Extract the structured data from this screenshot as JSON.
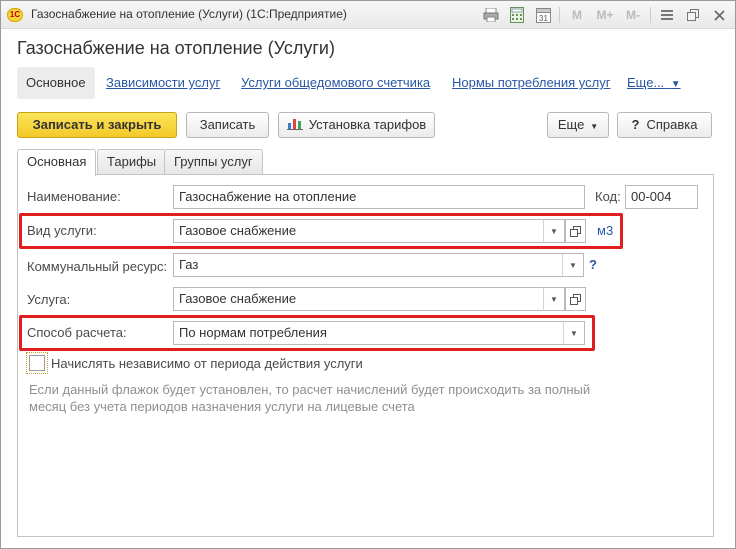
{
  "window": {
    "app_icon_text": "1С",
    "title": "Газоснабжение на отопление (Услуги)  (1С:Предприятие)",
    "toolbar_icons": [
      "print-icon",
      "calculator-icon",
      "calendar-icon",
      "m-button",
      "m-plus-button",
      "m-minus-button",
      "menu-icon",
      "restore-icon",
      "close-icon"
    ],
    "m_labels": {
      "m": "M",
      "mplus": "M+",
      "mminus": "M-"
    },
    "calendar_label": "31"
  },
  "form": {
    "title": "Газоснабжение на отопление (Услуги)"
  },
  "nav": {
    "items": [
      {
        "label": "Основное",
        "active": true
      },
      {
        "label": "Зависимости услуг",
        "active": false
      },
      {
        "label": "Услуги общедомового счетчика",
        "active": false
      },
      {
        "label": "Нормы потребления услуг",
        "active": false
      },
      {
        "label": "Еще...",
        "active": false
      }
    ]
  },
  "toolbar": {
    "save_close": "Записать и закрыть",
    "save": "Записать",
    "tariffs": "Установка тарифов",
    "more": "Еще",
    "help": "Справка",
    "help_icon": "?"
  },
  "tabs": [
    {
      "label": "Основная",
      "active": true
    },
    {
      "label": "Тарифы",
      "active": false
    },
    {
      "label": "Группы услуг",
      "active": false
    }
  ],
  "fields": {
    "name": {
      "label": "Наименование:",
      "value": "Газоснабжение на отопление"
    },
    "code": {
      "label": "Код:",
      "value": "00-004"
    },
    "service_type": {
      "label": "Вид услуги:",
      "value": "Газовое снабжение",
      "unit": "м3"
    },
    "resource": {
      "label": "Коммунальный ресурс:",
      "value": "Газ",
      "help": "?"
    },
    "service": {
      "label": "Услуга:",
      "value": "Газовое снабжение"
    },
    "calc_method": {
      "label": "Способ расчета:",
      "value": "По нормам потребления"
    }
  },
  "checkbox": {
    "label": "Начислять независимо от периода действия услуги",
    "checked": false
  },
  "hint": {
    "line1": "Если данный флажок будет установлен, то расчет начислений будет происходить за полный",
    "line2": "месяц без учета периодов назначения услуги на лицевые счета"
  },
  "colors": {
    "accent_yellow": "#f3c928",
    "link_blue": "#2b57a6",
    "highlight_red": "#e01e1e"
  }
}
